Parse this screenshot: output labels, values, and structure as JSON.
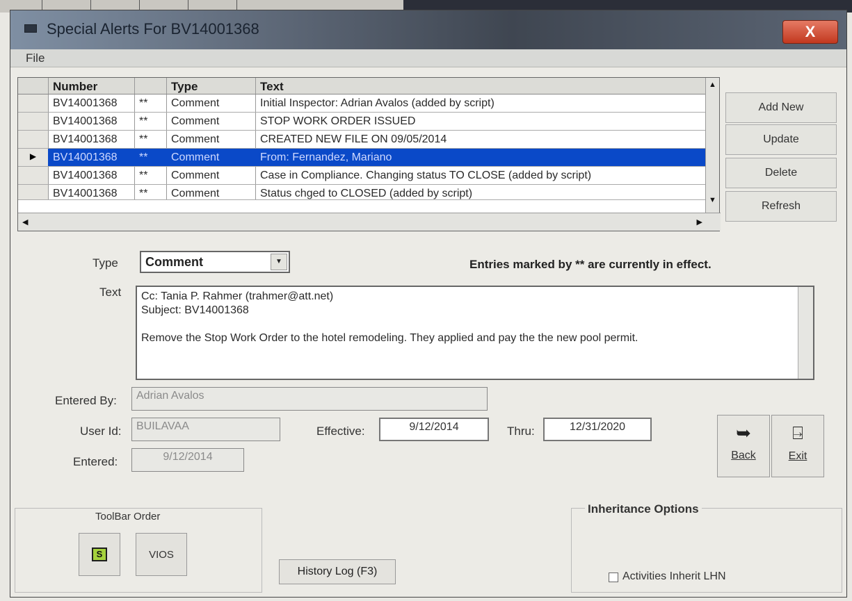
{
  "window": {
    "title": "Special Alerts For BV14001368",
    "close_label": "X"
  },
  "menu": {
    "file": "File"
  },
  "grid": {
    "headers": {
      "number": "Number",
      "type": "Type",
      "text": "Text"
    },
    "rows": [
      {
        "number": "BV14001368",
        "mark": "**",
        "type": "Comment",
        "text": "Initial Inspector: Adrian Avalos (added by script)"
      },
      {
        "number": "BV14001368",
        "mark": "**",
        "type": "Comment",
        "text": "STOP WORK ORDER ISSUED"
      },
      {
        "number": "BV14001368",
        "mark": "**",
        "type": "Comment",
        "text": "CREATED NEW FILE ON 09/05/2014"
      },
      {
        "number": "BV14001368",
        "mark": "**",
        "type": "Comment",
        "text": "From: Fernandez, Mariano"
      },
      {
        "number": "BV14001368",
        "mark": "**",
        "type": "Comment",
        "text": "Case in Compliance. Changing status TO CLOSE   (added by script)"
      },
      {
        "number": "BV14001368",
        "mark": "**",
        "type": "Comment",
        "text": "Status chged to CLOSED  (added by script)"
      }
    ]
  },
  "side_buttons": {
    "add_new": "Add New",
    "update": "Update",
    "delete": "Delete",
    "refresh": "Refresh"
  },
  "form": {
    "type_label": "Type",
    "type_value": "Comment",
    "note": "Entries marked by ** are currently in effect.",
    "text_label": "Text",
    "text_lines": [
      "Cc: Tania P. Rahmer (trahmer@att.net)",
      "Subject: BV14001368",
      "",
      "Remove the Stop Work Order to the hotel remodeling. They applied and pay the the new pool permit."
    ],
    "entered_by_label": "Entered By:",
    "entered_by_value": "Adrian Avalos",
    "user_id_label": "User Id:",
    "user_id_value": "BUILAVAA",
    "effective_label": "Effective:",
    "effective_value": "9/12/2014",
    "thru_label": "Thru:",
    "thru_value": "12/31/2020",
    "entered_label": "Entered:",
    "entered_value": "9/12/2014"
  },
  "nav": {
    "back": "Back",
    "exit": "Exit"
  },
  "toolbar_order": {
    "title": "ToolBar Order",
    "s_label": "S",
    "vios_label": "VIOS"
  },
  "history_button": "History Log (F3)",
  "inheritance": {
    "title": "Inheritance Options",
    "checkbox_label": "Activities Inherit LHN"
  }
}
